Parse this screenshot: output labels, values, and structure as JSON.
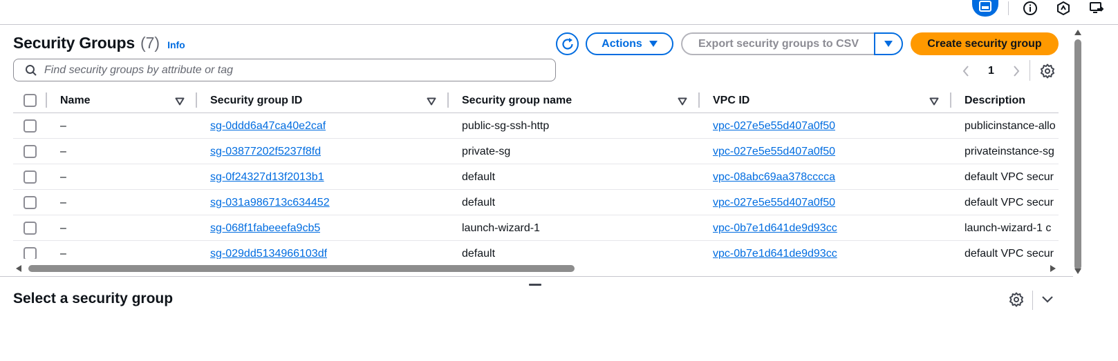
{
  "header": {
    "title": "Security Groups",
    "count": "(7)",
    "info_link": "Info"
  },
  "toolbar": {
    "actions_label": "Actions",
    "export_label": "Export security groups to CSV",
    "create_label": "Create security group"
  },
  "search": {
    "placeholder": "Find security groups by attribute or tag",
    "value": ""
  },
  "pagination": {
    "current_page": "1"
  },
  "table": {
    "columns": [
      "Name",
      "Security group ID",
      "Security group name",
      "VPC ID",
      "Description"
    ],
    "rows": [
      {
        "name": "–",
        "sg_id": "sg-0ddd6a47ca40e2caf",
        "sg_name": "public-sg-ssh-http",
        "vpc_id": "vpc-027e5e55d407a0f50",
        "description": "publicinstance-allo"
      },
      {
        "name": "–",
        "sg_id": "sg-03877202f5237f8fd",
        "sg_name": "private-sg",
        "vpc_id": "vpc-027e5e55d407a0f50",
        "description": "privateinstance-sg"
      },
      {
        "name": "–",
        "sg_id": "sg-0f24327d13f2013b1",
        "sg_name": "default",
        "vpc_id": "vpc-08abc69aa378cccca",
        "description": "default VPC secur"
      },
      {
        "name": "–",
        "sg_id": "sg-031a986713c634452",
        "sg_name": "default",
        "vpc_id": "vpc-027e5e55d407a0f50",
        "description": "default VPC secur"
      },
      {
        "name": "–",
        "sg_id": "sg-068f1fabeeefa9cb5",
        "sg_name": "launch-wizard-1",
        "vpc_id": "vpc-0b7e1d641de9d93cc",
        "description": "launch-wizard-1 c"
      },
      {
        "name": "–",
        "sg_id": "sg-029dd5134966103df",
        "sg_name": "default",
        "vpc_id": "vpc-0b7e1d641de9d93cc",
        "description": "default VPC secur"
      }
    ]
  },
  "details": {
    "title": "Select a security group"
  },
  "icons": {
    "top": [
      "panel-layout-icon",
      "info-circle-icon",
      "shield-hex-icon",
      "screen-share-icon"
    ]
  },
  "colors": {
    "link_blue": "#006ce0",
    "primary_orange": "#ff9900",
    "border_gray": "#c6c6cd",
    "text_dark": "#0f141a"
  }
}
